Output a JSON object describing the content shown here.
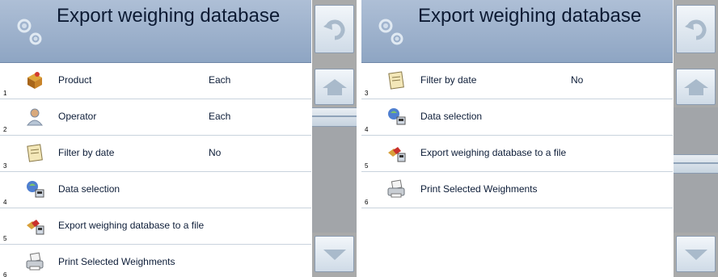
{
  "screens": [
    {
      "title": "Export weighing database",
      "items": [
        {
          "num": "1",
          "label": "Product",
          "value": "Each",
          "icon": "product-icon"
        },
        {
          "num": "2",
          "label": "Operator",
          "value": "Each",
          "icon": "operator-icon"
        },
        {
          "num": "3",
          "label": "Filter by date",
          "value": "No",
          "icon": "calendar-icon"
        },
        {
          "num": "4",
          "label": "Data selection",
          "value": "",
          "icon": "data-selection-icon"
        },
        {
          "num": "5",
          "label": "Export weighing database to a file",
          "value": "",
          "icon": "export-file-icon"
        },
        {
          "num": "6",
          "label": "Print Selected Weighments",
          "value": "",
          "icon": "printer-icon"
        }
      ]
    },
    {
      "title": "Export weighing database",
      "items": [
        {
          "num": "3",
          "label": "Filter by date",
          "value": "No",
          "icon": "calendar-icon"
        },
        {
          "num": "4",
          "label": "Data selection",
          "value": "",
          "icon": "data-selection-icon"
        },
        {
          "num": "5",
          "label": "Export weighing database to a file",
          "value": "",
          "icon": "export-file-icon"
        },
        {
          "num": "6",
          "label": "Print Selected Weighments",
          "value": "",
          "icon": "printer-icon"
        }
      ]
    }
  ],
  "scroll_position": [
    0.0,
    0.5
  ]
}
